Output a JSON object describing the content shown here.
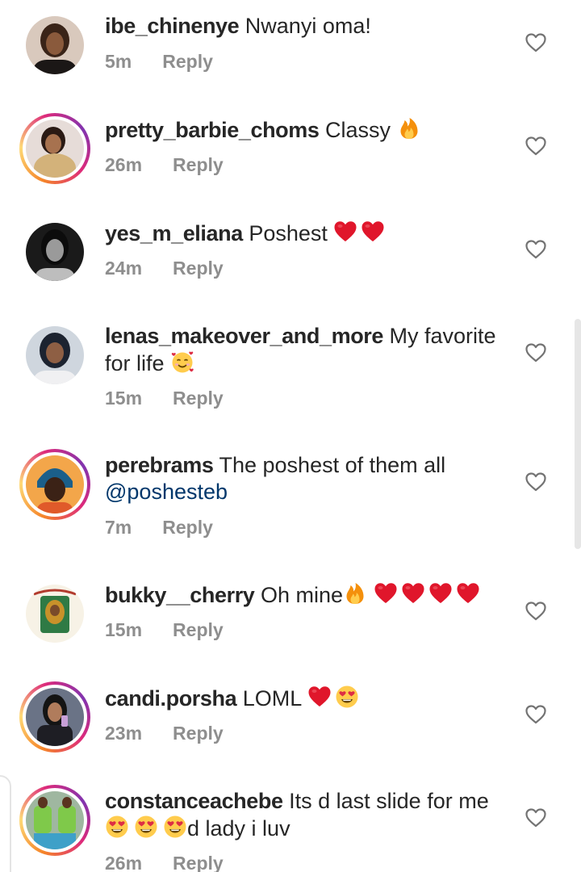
{
  "comments": [
    {
      "username": "ibe_chinenye",
      "text": "Nwanyi oma!",
      "time": "5m",
      "reply": "Reply"
    },
    {
      "username": "pretty_barbie_choms",
      "text": "Classy",
      "time": "26m",
      "reply": "Reply"
    },
    {
      "username": "yes_m_eliana",
      "text": "Poshest",
      "time": "24m",
      "reply": "Reply"
    },
    {
      "username": "lenas_makeover_and_more",
      "text": "My favorite",
      "text2": "for life",
      "time": "15m",
      "reply": "Reply"
    },
    {
      "username": "perebrams",
      "text": "The poshest of them all",
      "mention": "@poshesteb",
      "time": "7m",
      "reply": "Reply"
    },
    {
      "username": "bukky__cherry",
      "text": "Oh mine",
      "time": "15m",
      "reply": "Reply"
    },
    {
      "username": "candi.porsha",
      "text": "LOML",
      "time": "23m",
      "reply": "Reply"
    },
    {
      "username": "constanceachebe",
      "text": "Its d last slide for me",
      "text2": "d lady i luv",
      "time": "26m",
      "reply": "Reply"
    }
  ],
  "colors": {
    "text": "#262626",
    "meta": "#8e8e8e",
    "mention": "#00376b",
    "heart_emoji": "#e0162b"
  },
  "icons": {
    "like": "heart-outline-icon",
    "fire": "fire-emoji",
    "heart": "red-heart-emoji",
    "smiling_hearts": "smiling-face-with-hearts-emoji",
    "heart_eyes": "heart-eyes-emoji"
  }
}
